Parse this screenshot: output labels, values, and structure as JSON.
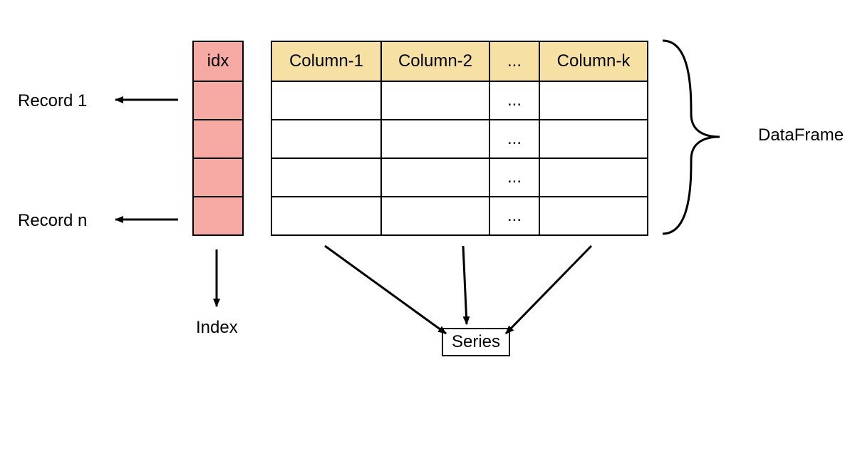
{
  "labels": {
    "record1": "Record 1",
    "recordN": "Record n",
    "indexLabel": "Index",
    "dataframeLabel": "DataFrame",
    "seriesLabel": "Series",
    "idxHeader": "idx"
  },
  "columns": {
    "c1": "Column-1",
    "c2": "Column-2",
    "c3": "...",
    "c4": "Column-k"
  },
  "ellipsis": "...",
  "colors": {
    "indexFill": "#f7a9a4",
    "headerFill": "#f6e0a4"
  },
  "structure": {
    "indexRows": 5,
    "dataRows": 4,
    "dataCols": 4
  }
}
